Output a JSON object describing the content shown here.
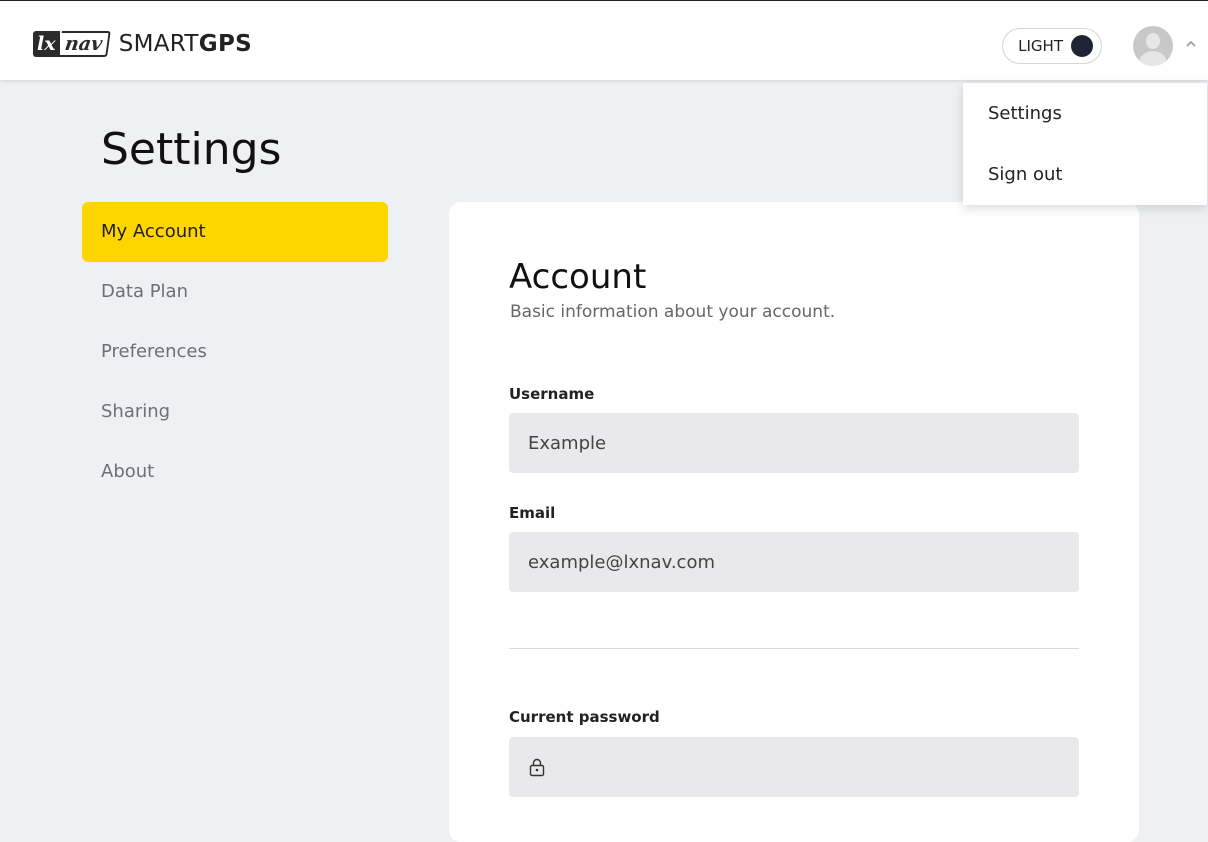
{
  "header": {
    "logo_lx": "lx",
    "logo_nav": "nav",
    "brand_light": "SMART",
    "brand_bold": "GPS",
    "theme_toggle_label": "LIGHT"
  },
  "user_menu": {
    "items": [
      {
        "label": "Settings"
      },
      {
        "label": "Sign out"
      }
    ]
  },
  "page": {
    "title": "Settings"
  },
  "sidebar": {
    "items": [
      {
        "label": "My Account",
        "active": true
      },
      {
        "label": "Data Plan"
      },
      {
        "label": "Preferences"
      },
      {
        "label": "Sharing"
      },
      {
        "label": "About"
      }
    ]
  },
  "account": {
    "title": "Account",
    "subtitle": "Basic information about your account.",
    "username_label": "Username",
    "username_value": "Example",
    "email_label": "Email",
    "email_value": "example@lxnav.com",
    "current_password_label": "Current password"
  },
  "colors": {
    "accent": "#ffd500",
    "background": "#eef0f4",
    "field": "#e9e9ec"
  }
}
